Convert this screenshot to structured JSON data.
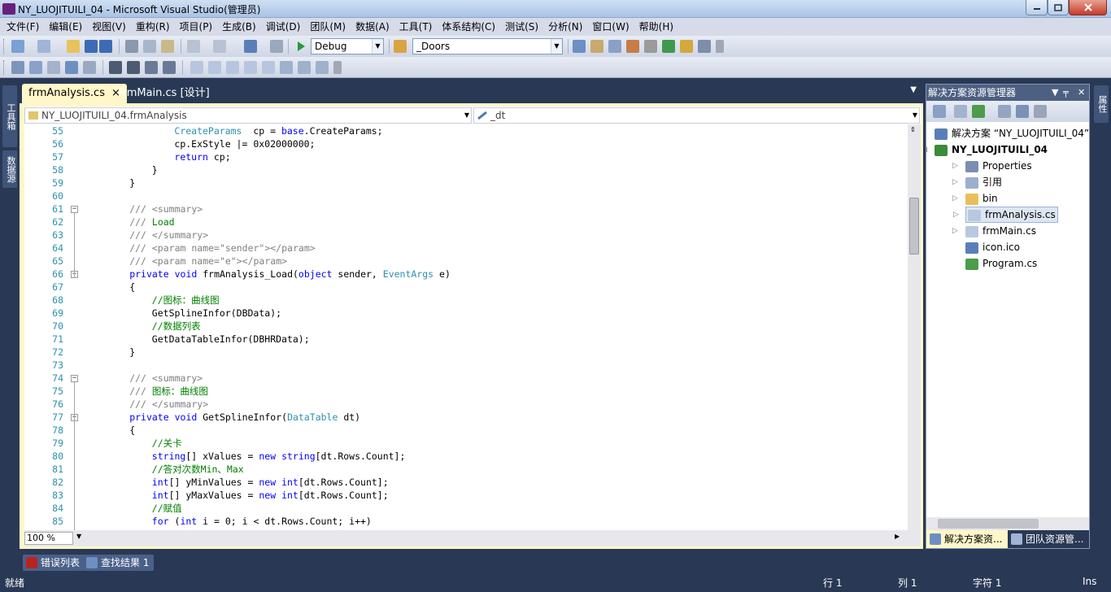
{
  "window": {
    "title": "NY_LUOJITUILI_04 - Microsoft Visual Studio(管理员)"
  },
  "menu": [
    "文件(F)",
    "编辑(E)",
    "视图(V)",
    "重构(R)",
    "项目(P)",
    "生成(B)",
    "调试(D)",
    "团队(M)",
    "数据(A)",
    "工具(T)",
    "体系结构(C)",
    "测试(S)",
    "分析(N)",
    "窗口(W)",
    "帮助(H)"
  ],
  "toolbar": {
    "config": "Debug",
    "find": "_Doors"
  },
  "left_strip": {
    "toolbox": "工具箱",
    "datasource": "数据源"
  },
  "right_strip": {
    "properties": "属性"
  },
  "tabs": {
    "active": "frmAnalysis.cs",
    "close": "×",
    "other": "frmMain.cs [设计]"
  },
  "nav": {
    "class": "NY_LUOJITUILI_04.frmAnalysis",
    "member": "_dt"
  },
  "zoom": "100 %",
  "code": [
    {
      "n": "55",
      "t": [
        [
          "tp",
          "CreateParams"
        ],
        [
          "",
          "  cp = "
        ],
        [
          "kw",
          "base"
        ],
        [
          "",
          ".CreateParams;"
        ]
      ],
      "i": 16
    },
    {
      "n": "56",
      "t": [
        [
          "",
          "cp.ExStyle |= 0x02000000;"
        ]
      ],
      "i": 16
    },
    {
      "n": "57",
      "t": [
        [
          "kw",
          "return"
        ],
        [
          "",
          " cp;"
        ]
      ],
      "i": 16
    },
    {
      "n": "58",
      "t": [
        [
          "",
          "}"
        ]
      ],
      "i": 12
    },
    {
      "n": "59",
      "t": [
        [
          "",
          "}"
        ]
      ],
      "i": 8
    },
    {
      "n": "60",
      "t": [],
      "i": 8
    },
    {
      "n": "61",
      "t": [
        [
          "xd",
          "/// "
        ],
        [
          "xd",
          "<summary>"
        ]
      ],
      "i": 8,
      "f": true
    },
    {
      "n": "62",
      "t": [
        [
          "xd",
          "/// "
        ],
        [
          "cm",
          "Load"
        ]
      ],
      "i": 8
    },
    {
      "n": "63",
      "t": [
        [
          "xd",
          "/// </summary>"
        ]
      ],
      "i": 8
    },
    {
      "n": "64",
      "t": [
        [
          "xd",
          "/// <param name=\"sender\"></param>"
        ]
      ],
      "i": 8
    },
    {
      "n": "65",
      "t": [
        [
          "xd",
          "/// <param name=\"e\"></param>"
        ]
      ],
      "i": 8
    },
    {
      "n": "66",
      "t": [
        [
          "kw",
          "private"
        ],
        [
          "",
          " "
        ],
        [
          "kw",
          "void"
        ],
        [
          "",
          " frmAnalysis_Load("
        ],
        [
          "kw",
          "object"
        ],
        [
          "",
          " sender, "
        ],
        [
          "tp",
          "EventArgs"
        ],
        [
          "",
          " e)"
        ]
      ],
      "i": 8,
      "f": true
    },
    {
      "n": "67",
      "t": [
        [
          "",
          "{"
        ]
      ],
      "i": 8
    },
    {
      "n": "68",
      "t": [
        [
          "cm",
          "//图标：曲线图"
        ]
      ],
      "i": 12
    },
    {
      "n": "69",
      "t": [
        [
          "",
          "GetSplineInfor(DBData);"
        ]
      ],
      "i": 12
    },
    {
      "n": "70",
      "t": [
        [
          "cm",
          "//数据列表"
        ]
      ],
      "i": 12
    },
    {
      "n": "71",
      "t": [
        [
          "",
          "GetDataTableInfor(DBHRData);"
        ]
      ],
      "i": 12
    },
    {
      "n": "72",
      "t": [
        [
          "",
          "}"
        ]
      ],
      "i": 8
    },
    {
      "n": "73",
      "t": [],
      "i": 8
    },
    {
      "n": "74",
      "t": [
        [
          "xd",
          "/// <summary>"
        ]
      ],
      "i": 8,
      "f": true
    },
    {
      "n": "75",
      "t": [
        [
          "xd",
          "/// "
        ],
        [
          "cm",
          "图标：曲线图"
        ]
      ],
      "i": 8
    },
    {
      "n": "76",
      "t": [
        [
          "xd",
          "/// </summary>"
        ]
      ],
      "i": 8
    },
    {
      "n": "77",
      "t": [
        [
          "kw",
          "private"
        ],
        [
          "",
          " "
        ],
        [
          "kw",
          "void"
        ],
        [
          "",
          " GetSplineInfor("
        ],
        [
          "tp",
          "DataTable"
        ],
        [
          "",
          " dt)"
        ]
      ],
      "i": 8,
      "f": true
    },
    {
      "n": "78",
      "t": [
        [
          "",
          "{"
        ]
      ],
      "i": 8
    },
    {
      "n": "79",
      "t": [
        [
          "cm",
          "//关卡"
        ]
      ],
      "i": 12
    },
    {
      "n": "80",
      "t": [
        [
          "kw",
          "string"
        ],
        [
          "",
          "[] xValues = "
        ],
        [
          "kw",
          "new"
        ],
        [
          "",
          " "
        ],
        [
          "kw",
          "string"
        ],
        [
          "",
          "[dt.Rows.Count];"
        ]
      ],
      "i": 12
    },
    {
      "n": "81",
      "t": [
        [
          "cm",
          "//答对次数Min、Max"
        ]
      ],
      "i": 12
    },
    {
      "n": "82",
      "t": [
        [
          "kw",
          "int"
        ],
        [
          "",
          "[] yMinValues = "
        ],
        [
          "kw",
          "new"
        ],
        [
          "",
          " "
        ],
        [
          "kw",
          "int"
        ],
        [
          "",
          "[dt.Rows.Count];"
        ]
      ],
      "i": 12
    },
    {
      "n": "83",
      "t": [
        [
          "kw",
          "int"
        ],
        [
          "",
          "[] yMaxValues = "
        ],
        [
          "kw",
          "new"
        ],
        [
          "",
          " "
        ],
        [
          "kw",
          "int"
        ],
        [
          "",
          "[dt.Rows.Count];"
        ]
      ],
      "i": 12
    },
    {
      "n": "84",
      "t": [
        [
          "cm",
          "//赋值"
        ]
      ],
      "i": 12
    },
    {
      "n": "85",
      "t": [
        [
          "kw",
          "for"
        ],
        [
          "",
          " ("
        ],
        [
          "kw",
          "int"
        ],
        [
          "",
          " i = 0; i < dt.Rows.Count; i++)"
        ]
      ],
      "i": 12
    }
  ],
  "solution_explorer": {
    "title": "解决方案资源管理器",
    "items": [
      {
        "label": "解决方案 “NY_LUOJITUILI_04”",
        "depth": 0,
        "bold": false,
        "exp": "",
        "color": "#5a7fb8"
      },
      {
        "label": "NY_LUOJITUILI_04",
        "depth": 0,
        "bold": true,
        "exp": "◢",
        "color": "#3a8c3a"
      },
      {
        "label": "Properties",
        "depth": 1,
        "bold": false,
        "exp": "▷",
        "color": "#7a8fb0"
      },
      {
        "label": "引用",
        "depth": 1,
        "bold": false,
        "exp": "▷",
        "color": "#9ab0cc"
      },
      {
        "label": "bin",
        "depth": 1,
        "bold": false,
        "exp": "▷",
        "color": "#e7c05a"
      },
      {
        "label": "frmAnalysis.cs",
        "depth": 1,
        "bold": false,
        "exp": "▷",
        "color": "#b8c8e0",
        "sel": true
      },
      {
        "label": "frmMain.cs",
        "depth": 1,
        "bold": false,
        "exp": "▷",
        "color": "#b8c8e0"
      },
      {
        "label": "icon.ico",
        "depth": 1,
        "bold": false,
        "exp": "",
        "color": "#5a7fb8"
      },
      {
        "label": "Program.cs",
        "depth": 1,
        "bold": false,
        "exp": "",
        "color": "#4c9c4c"
      }
    ],
    "bottom_tabs": [
      "解决方案资...",
      "团队资源管..."
    ]
  },
  "bottom_tabs": [
    "错误列表",
    "查找结果 1"
  ],
  "status": {
    "ready": "就绪",
    "row": "行 1",
    "col": "列 1",
    "char": "字符 1",
    "ins": "Ins"
  },
  "colors": {
    "chrome": "#293955",
    "active_tab": "#fff7c9",
    "keyword": "#0000ff",
    "comment": "#008000",
    "type": "#2b91af"
  }
}
